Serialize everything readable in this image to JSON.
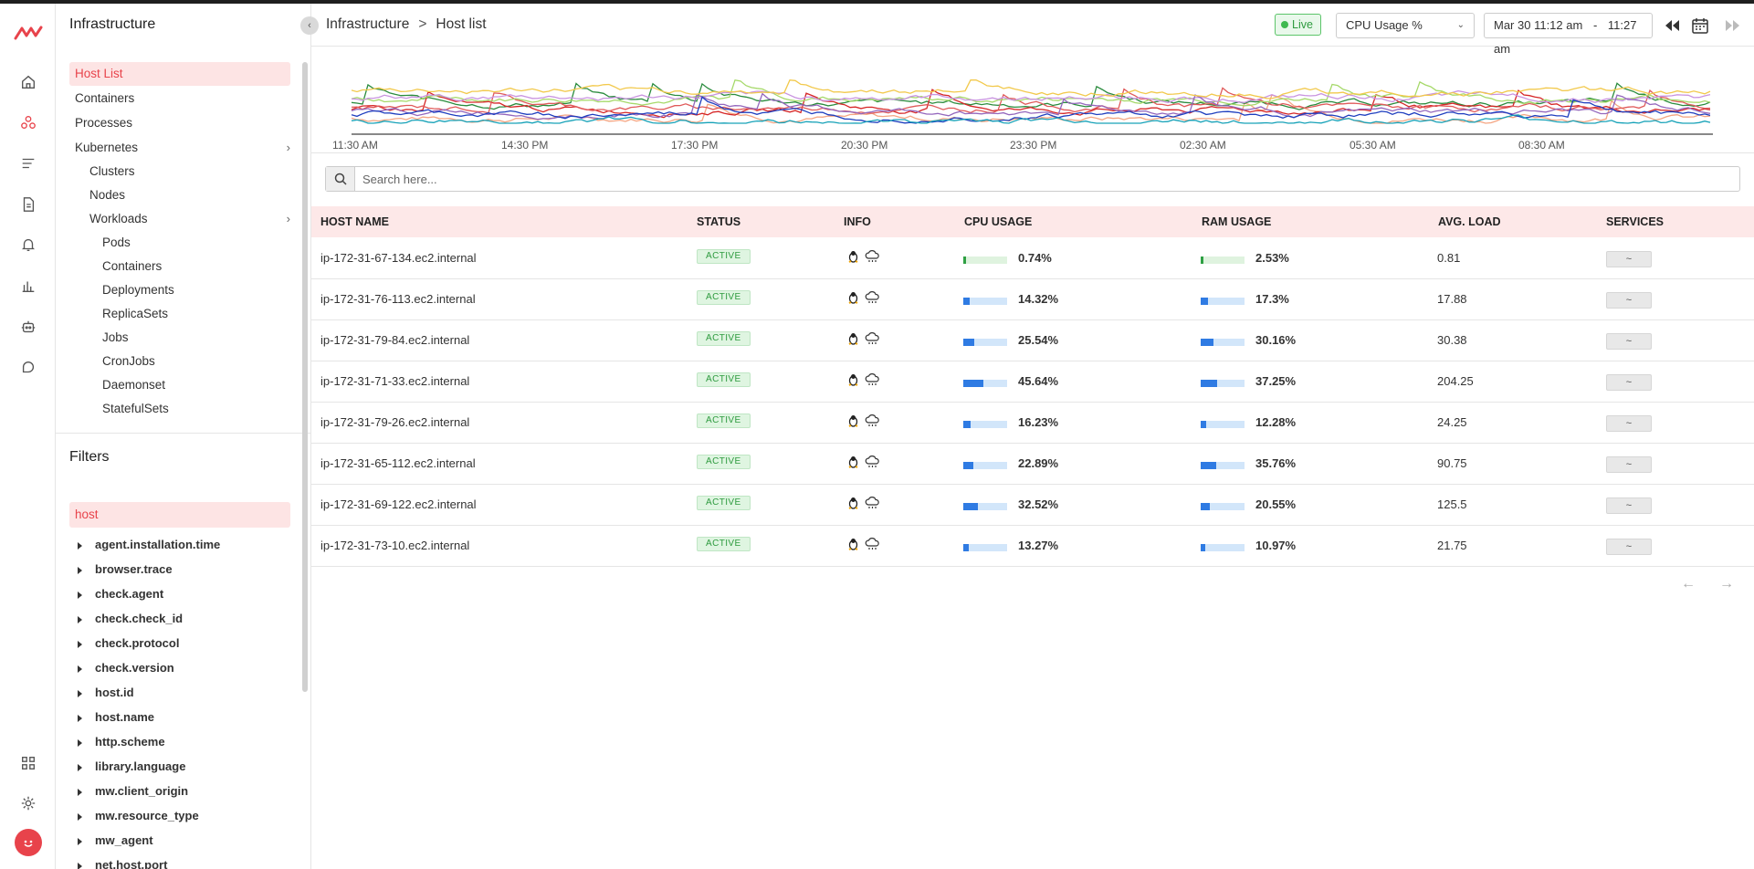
{
  "app": {
    "logo_icon": "middleware-logo-icon",
    "brand_color": "#e8434b"
  },
  "rail": {
    "icons": [
      "home-icon",
      "infrastructure-icon",
      "logs-icon",
      "document-icon",
      "bell-icon",
      "bar-chart-icon",
      "robot-icon",
      "support-icon",
      "grid-icon",
      "gear-icon",
      "avatar-icon"
    ]
  },
  "leftnav": {
    "title": "Infrastructure",
    "items": [
      {
        "label": "Host List",
        "active": true
      },
      {
        "label": "Containers"
      },
      {
        "label": "Processes"
      },
      {
        "label": "Kubernetes",
        "expandable": true
      },
      {
        "label": "Clusters"
      },
      {
        "label": "Nodes"
      },
      {
        "label": "Workloads",
        "expandable": true
      },
      {
        "label": "Pods"
      },
      {
        "label": "Containers"
      },
      {
        "label": "Deployments"
      },
      {
        "label": "ReplicaSets"
      },
      {
        "label": "Jobs"
      },
      {
        "label": "CronJobs"
      },
      {
        "label": "Daemonset"
      },
      {
        "label": "StatefulSets"
      }
    ],
    "filters_title": "Filters",
    "filter_value": "host",
    "facets": [
      "agent.installation.time",
      "browser.trace",
      "check.agent",
      "check.check_id",
      "check.protocol",
      "check.version",
      "host.id",
      "host.name",
      "http.scheme",
      "library.language",
      "mw.client_origin",
      "mw.resource_type",
      "mw_agent",
      "net.host.port"
    ]
  },
  "header": {
    "breadcrumb": {
      "root": "Infrastructure",
      "separator": ">",
      "current": "Host list"
    },
    "live_label": "Live",
    "metric": "CPU Usage %",
    "time_start": "Mar 30 11:12 am",
    "time_separator": "-",
    "time_end": "11:27 am"
  },
  "chart": {
    "x_ticks": [
      "11:30 AM",
      "14:30 PM",
      "17:30 PM",
      "20:30 PM",
      "23:30 PM",
      "02:30 AM",
      "05:30 AM",
      "08:30 AM"
    ],
    "series_colors": [
      "#f4a582",
      "#2b8c3e",
      "#d62728",
      "#e05a5a",
      "#a6d96a",
      "#c994e0",
      "#9467bd",
      "#1f3fbf",
      "#17a2b8",
      "#f2c94c"
    ]
  },
  "search": {
    "placeholder": "Search here..."
  },
  "table": {
    "columns": [
      "HOST NAME",
      "STATUS",
      "INFO",
      "CPU USAGE",
      "RAM USAGE",
      "AVG. LOAD",
      "SERVICES"
    ],
    "rows": [
      {
        "host": "ip-172-31-67-134.ec2.internal",
        "status": "ACTIVE",
        "cpu": "0.74%",
        "cpu_frac": 0.0074,
        "ram": "2.53%",
        "ram_frac": 0.0253,
        "load": "0.81",
        "services": "~",
        "green": true
      },
      {
        "host": "ip-172-31-76-113.ec2.internal",
        "status": "ACTIVE",
        "cpu": "14.32%",
        "cpu_frac": 0.1432,
        "ram": "17.3%",
        "ram_frac": 0.173,
        "load": "17.88",
        "services": "~"
      },
      {
        "host": "ip-172-31-79-84.ec2.internal",
        "status": "ACTIVE",
        "cpu": "25.54%",
        "cpu_frac": 0.2554,
        "ram": "30.16%",
        "ram_frac": 0.3016,
        "load": "30.38",
        "services": "~"
      },
      {
        "host": "ip-172-31-71-33.ec2.internal",
        "status": "ACTIVE",
        "cpu": "45.64%",
        "cpu_frac": 0.4564,
        "ram": "37.25%",
        "ram_frac": 0.3725,
        "load": "204.25",
        "services": "~"
      },
      {
        "host": "ip-172-31-79-26.ec2.internal",
        "status": "ACTIVE",
        "cpu": "16.23%",
        "cpu_frac": 0.1623,
        "ram": "12.28%",
        "ram_frac": 0.1228,
        "load": "24.25",
        "services": "~"
      },
      {
        "host": "ip-172-31-65-112.ec2.internal",
        "status": "ACTIVE",
        "cpu": "22.89%",
        "cpu_frac": 0.2289,
        "ram": "35.76%",
        "ram_frac": 0.3576,
        "load": "90.75",
        "services": "~"
      },
      {
        "host": "ip-172-31-69-122.ec2.internal",
        "status": "ACTIVE",
        "cpu": "32.52%",
        "cpu_frac": 0.3252,
        "ram": "20.55%",
        "ram_frac": 0.2055,
        "load": "125.5",
        "services": "~"
      },
      {
        "host": "ip-172-31-73-10.ec2.internal",
        "status": "ACTIVE",
        "cpu": "13.27%",
        "cpu_frac": 0.1327,
        "ram": "10.97%",
        "ram_frac": 0.1097,
        "load": "21.75",
        "services": "~"
      }
    ]
  },
  "pager": {
    "prev_icon": "arrow-left-icon",
    "next_icon": "arrow-right-icon"
  }
}
